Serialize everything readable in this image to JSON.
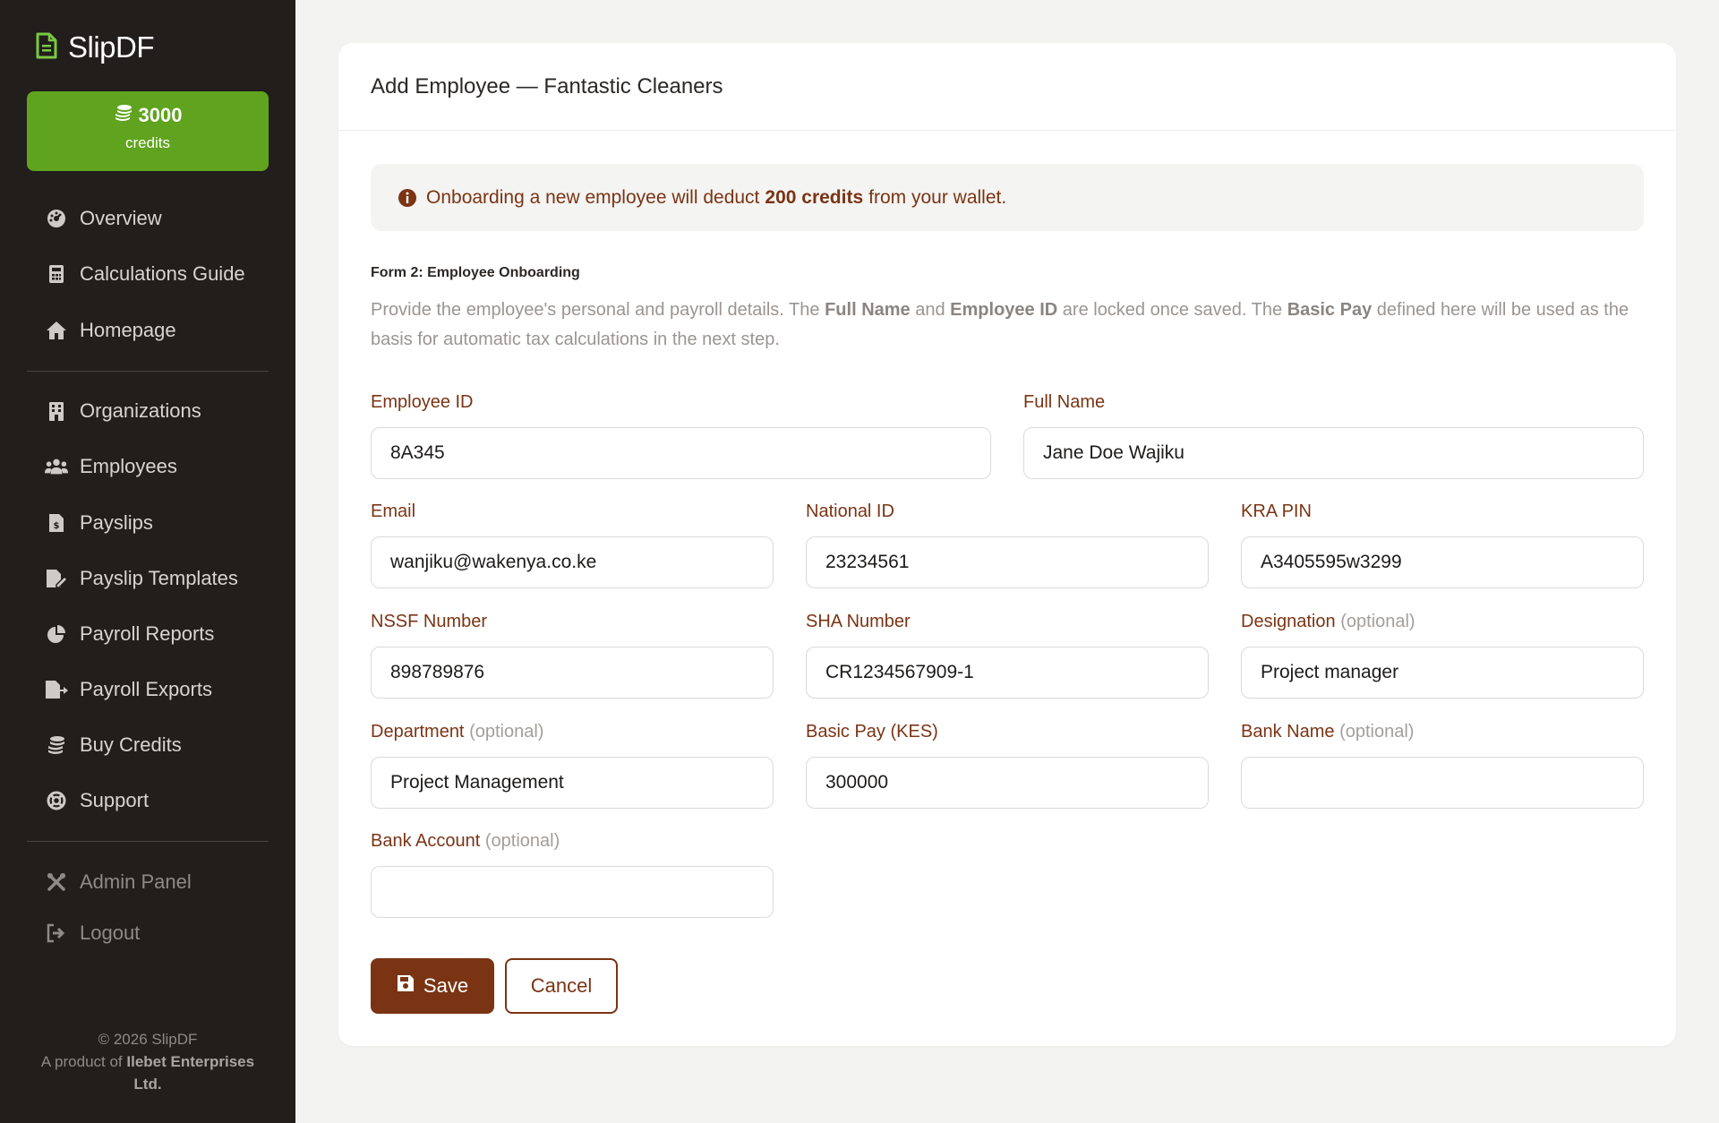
{
  "app": {
    "name": "SlipDF"
  },
  "credits": {
    "amount": "3000",
    "label": "credits"
  },
  "nav": {
    "overview": "Overview",
    "calc_guide": "Calculations Guide",
    "homepage": "Homepage",
    "organizations": "Organizations",
    "employees": "Employees",
    "payslips": "Payslips",
    "payslip_templates": "Payslip Templates",
    "payroll_reports": "Payroll Reports",
    "payroll_exports": "Payroll Exports",
    "buy_credits": "Buy Credits",
    "support": "Support",
    "admin_panel": "Admin Panel",
    "logout": "Logout"
  },
  "footer": {
    "copyright": "© 2026 SlipDF",
    "product_prefix": "A product of",
    "company": "Ilebet Enterprises Ltd."
  },
  "page": {
    "title": "Add Employee — Fantastic Cleaners"
  },
  "notice": {
    "before": "Onboarding a new employee will deduct",
    "highlight": "200 credits",
    "after": "from your wallet."
  },
  "form": {
    "title": "Form 2: Employee Onboarding",
    "desc_1": "Provide the employee's personal and payroll details. The",
    "desc_b1": "Full Name",
    "desc_2": "and",
    "desc_b2": "Employee ID",
    "desc_3": "are locked once saved. The",
    "desc_b3": "Basic Pay",
    "desc_4": "defined here will be used as the basis for automatic tax calculations in the next step.",
    "optional": "(optional)",
    "fields": {
      "employee_id": {
        "label": "Employee ID",
        "value": "8A345"
      },
      "full_name": {
        "label": "Full Name",
        "value": "Jane Doe Wajiku"
      },
      "email": {
        "label": "Email",
        "value": "wanjiku@wakenya.co.ke"
      },
      "national_id": {
        "label": "National ID",
        "value": "23234561"
      },
      "kra_pin": {
        "label": "KRA PIN",
        "value": "A3405595w3299"
      },
      "nssf": {
        "label": "NSSF Number",
        "value": "898789876"
      },
      "sha": {
        "label": "SHA Number",
        "value": "CR1234567909-1"
      },
      "designation": {
        "label": "Designation",
        "value": "Project manager"
      },
      "department": {
        "label": "Department",
        "value": "Project Management"
      },
      "basic_pay": {
        "label": "Basic Pay (KES)",
        "value": "300000"
      },
      "bank_name": {
        "label": "Bank Name",
        "value": ""
      },
      "bank_account": {
        "label": "Bank Account",
        "value": ""
      }
    },
    "save_label": "Save",
    "cancel_label": "Cancel"
  },
  "colors": {
    "sidebar_bg": "#221e1c",
    "accent_green": "#5fa31e",
    "brand_brown": "#7a3414",
    "page_bg": "#f3f3f2"
  }
}
